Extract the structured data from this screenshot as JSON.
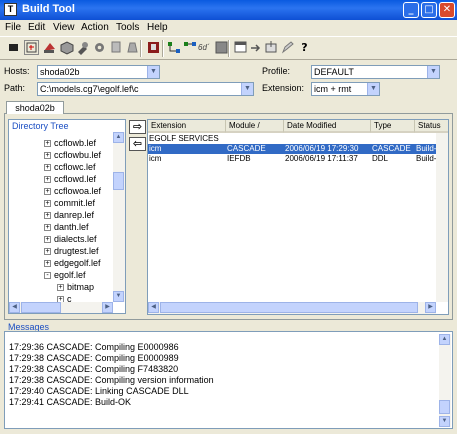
{
  "window": {
    "title": "Build Tool",
    "icon_glyph": "T"
  },
  "menu": [
    {
      "label": "File"
    },
    {
      "label": "Edit"
    },
    {
      "label": "View"
    },
    {
      "label": "Action"
    },
    {
      "label": "Tools"
    },
    {
      "label": "Help"
    }
  ],
  "form": {
    "hosts_label": "Hosts:",
    "hosts_value": "shoda02b",
    "path_label": "Path:",
    "path_value": "C:\\models.cg7\\egolf.lef\\c",
    "profile_label": "Profile:",
    "profile_value": "DEFAULT",
    "extension_label": "Extension:",
    "extension_value": "icm + rmt"
  },
  "host_tab": {
    "label": "shoda02b"
  },
  "tree": {
    "title": "Directory Tree",
    "items": [
      {
        "label": "ccflowb.lef",
        "indent": 1,
        "expander": "+"
      },
      {
        "label": "ccflowbu.lef",
        "indent": 1,
        "expander": "+"
      },
      {
        "label": "ccflowc.lef",
        "indent": 1,
        "expander": "+"
      },
      {
        "label": "ccflowd.lef",
        "indent": 1,
        "expander": "+"
      },
      {
        "label": "ccflowoa.lef",
        "indent": 1,
        "expander": "+"
      },
      {
        "label": "commit.lef",
        "indent": 1,
        "expander": "+"
      },
      {
        "label": "danrep.lef",
        "indent": 1,
        "expander": "+"
      },
      {
        "label": "danth.lef",
        "indent": 1,
        "expander": "+"
      },
      {
        "label": "dialects.lef",
        "indent": 1,
        "expander": "+"
      },
      {
        "label": "drugtest.lef",
        "indent": 1,
        "expander": "+"
      },
      {
        "label": "edgegolf.lef",
        "indent": 1,
        "expander": "+"
      },
      {
        "label": "egolf.lef",
        "indent": 1,
        "expander": "-"
      },
      {
        "label": "bitmap",
        "indent": 2,
        "expander": "+"
      },
      {
        "label": "c",
        "indent": 2,
        "expander": "+"
      }
    ]
  },
  "table": {
    "columns": [
      "Extension",
      "Module /",
      "Date Modified",
      "Type",
      "Status"
    ],
    "group_label": "EGOLF SERVICES",
    "rows": [
      {
        "extension": "icm",
        "module": "CASCADE",
        "date": "2006/06/19 17:29:30",
        "type": "CASCADE",
        "status": "Build-OK",
        "selected": true
      },
      {
        "extension": "icm",
        "module": "IEFDB",
        "date": "2006/06/19 17:11:37",
        "type": "DDL",
        "status": "Build-OK",
        "selected": false
      }
    ]
  },
  "messages": {
    "title": "Messages",
    "lines": [
      "17:29:36 CASCADE: Compiling E0000986",
      "17:29:38 CASCADE: Compiling E0000989",
      "17:29:38 CASCADE: Compiling F7483820",
      "17:29:38 CASCADE: Compiling version information",
      "17:29:40 CASCADE: Linking CASCADE DLL",
      "17:29:41 CASCADE: Build-OK"
    ]
  },
  "toolbar": {
    "icons": [
      "stop-icon",
      "build-icon",
      "compile-icon",
      "package-icon",
      "tool-icon",
      "gear-icon",
      "copy-icon",
      "clean-icon",
      "book-icon",
      "tree-icon",
      "hierarchy-icon",
      "link-icon",
      "grid-icon",
      "window-icon",
      "export-icon",
      "import-icon",
      "edit-icon",
      "help-icon"
    ],
    "help_glyph": "?"
  },
  "colors": {
    "selection": "#316ac5",
    "title_bar": "#0a5ae0",
    "tree_title": "#1c4fc3"
  }
}
